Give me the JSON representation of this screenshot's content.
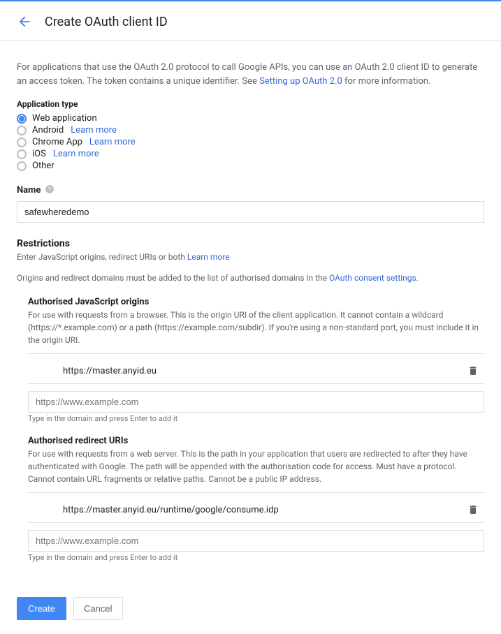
{
  "header": {
    "title": "Create OAuth client ID"
  },
  "intro": {
    "prefix": "For applications that use the OAuth 2.0 protocol to call Google APIs, you can use an OAuth 2.0 client ID to generate an access token. The token contains a unique identifier. See ",
    "link": "Setting up OAuth 2.0",
    "suffix": " for more information."
  },
  "appType": {
    "label": "Application type",
    "options": [
      {
        "label": "Web application",
        "selected": true
      },
      {
        "label": "Android",
        "learn": "Learn more"
      },
      {
        "label": "Chrome App",
        "learn": "Learn more"
      },
      {
        "label": "iOS",
        "learn": "Learn more"
      },
      {
        "label": "Other"
      }
    ]
  },
  "name": {
    "label": "Name",
    "value": "safewheredemo"
  },
  "restrictions": {
    "title": "Restrictions",
    "subtitle_prefix": "Enter JavaScript origins, redirect URIs or both ",
    "subtitle_link": "Learn more",
    "note_prefix": "Origins and redirect domains must be added to the list of authorised domains in the ",
    "note_link": "OAuth consent settings",
    "note_suffix": "."
  },
  "jsOrigins": {
    "title": "Authorised JavaScript origins",
    "desc": "For use with requests from a browser. This is the origin URI of the client application. It cannot contain a wildcard (https://*.example.com) or a path (https://example.com/subdir). If you're using a non-standard port, you must include it in the origin URI.",
    "entries": [
      "https://master.anyid.eu"
    ],
    "placeholder": "https://www.example.com",
    "hint": "Type in the domain and press Enter to add it"
  },
  "redirectUris": {
    "title": "Authorised redirect URIs",
    "desc": "For use with requests from a web server. This is the path in your application that users are redirected to after they have authenticated with Google. The path will be appended with the authorisation code for access. Must have a protocol. Cannot contain URL fragments or relative paths. Cannot be a public IP address.",
    "entries": [
      "https://master.anyid.eu/runtime/google/consume.idp"
    ],
    "placeholder": "https://www.example.com",
    "hint": "Type in the domain and press Enter to add it"
  },
  "buttons": {
    "create": "Create",
    "cancel": "Cancel"
  }
}
